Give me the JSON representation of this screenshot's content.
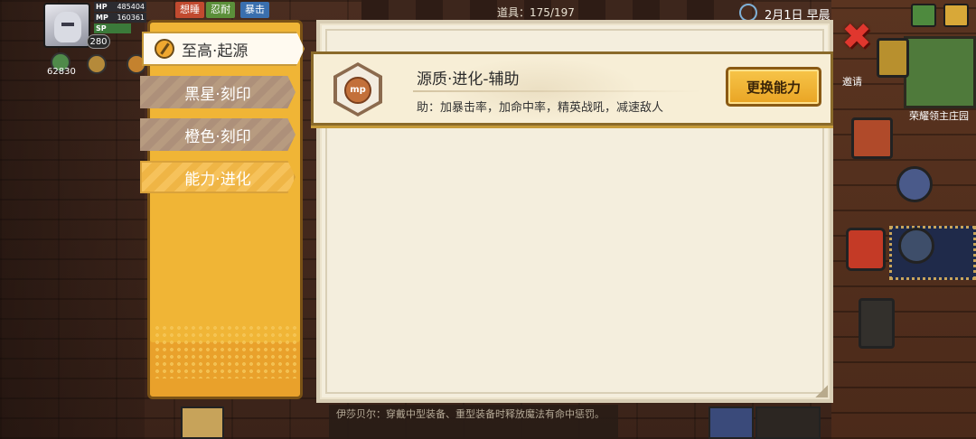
{
  "hud": {
    "level": "280",
    "hp_label": "HP",
    "hp_value": "485404",
    "mp_label": "MP",
    "mp_value": "160361",
    "sp_label": "SP",
    "status_chips": [
      "想睡",
      "忍耐",
      "暴击"
    ],
    "currency": "62830"
  },
  "topbar": {
    "items_count": "道具：175/197",
    "date": "2月1日  早晨"
  },
  "side_labels": {
    "invite": "邀请",
    "manor": "荣耀领主庄园"
  },
  "tabs": [
    {
      "label": "至高·起源",
      "state": "active"
    },
    {
      "label": "黑星·刻印",
      "state": "disabled"
    },
    {
      "label": "橙色·刻印",
      "state": "disabled"
    },
    {
      "label": "能力·进化",
      "state": "normal"
    }
  ],
  "ability": {
    "emblem_text": "mp",
    "title": "源质·进化-辅助",
    "description": "助：加暴击率，加命中率，精英战吼，减速敌人",
    "change_button": "更换能力"
  },
  "tooltip": {
    "text": "伊莎贝尔：穿戴中型装备、重型装备时释放魔法有命中惩罚。"
  },
  "colors": {
    "accent": "#f0b536",
    "close": "#e0372e",
    "panel": "#f4eedd"
  }
}
